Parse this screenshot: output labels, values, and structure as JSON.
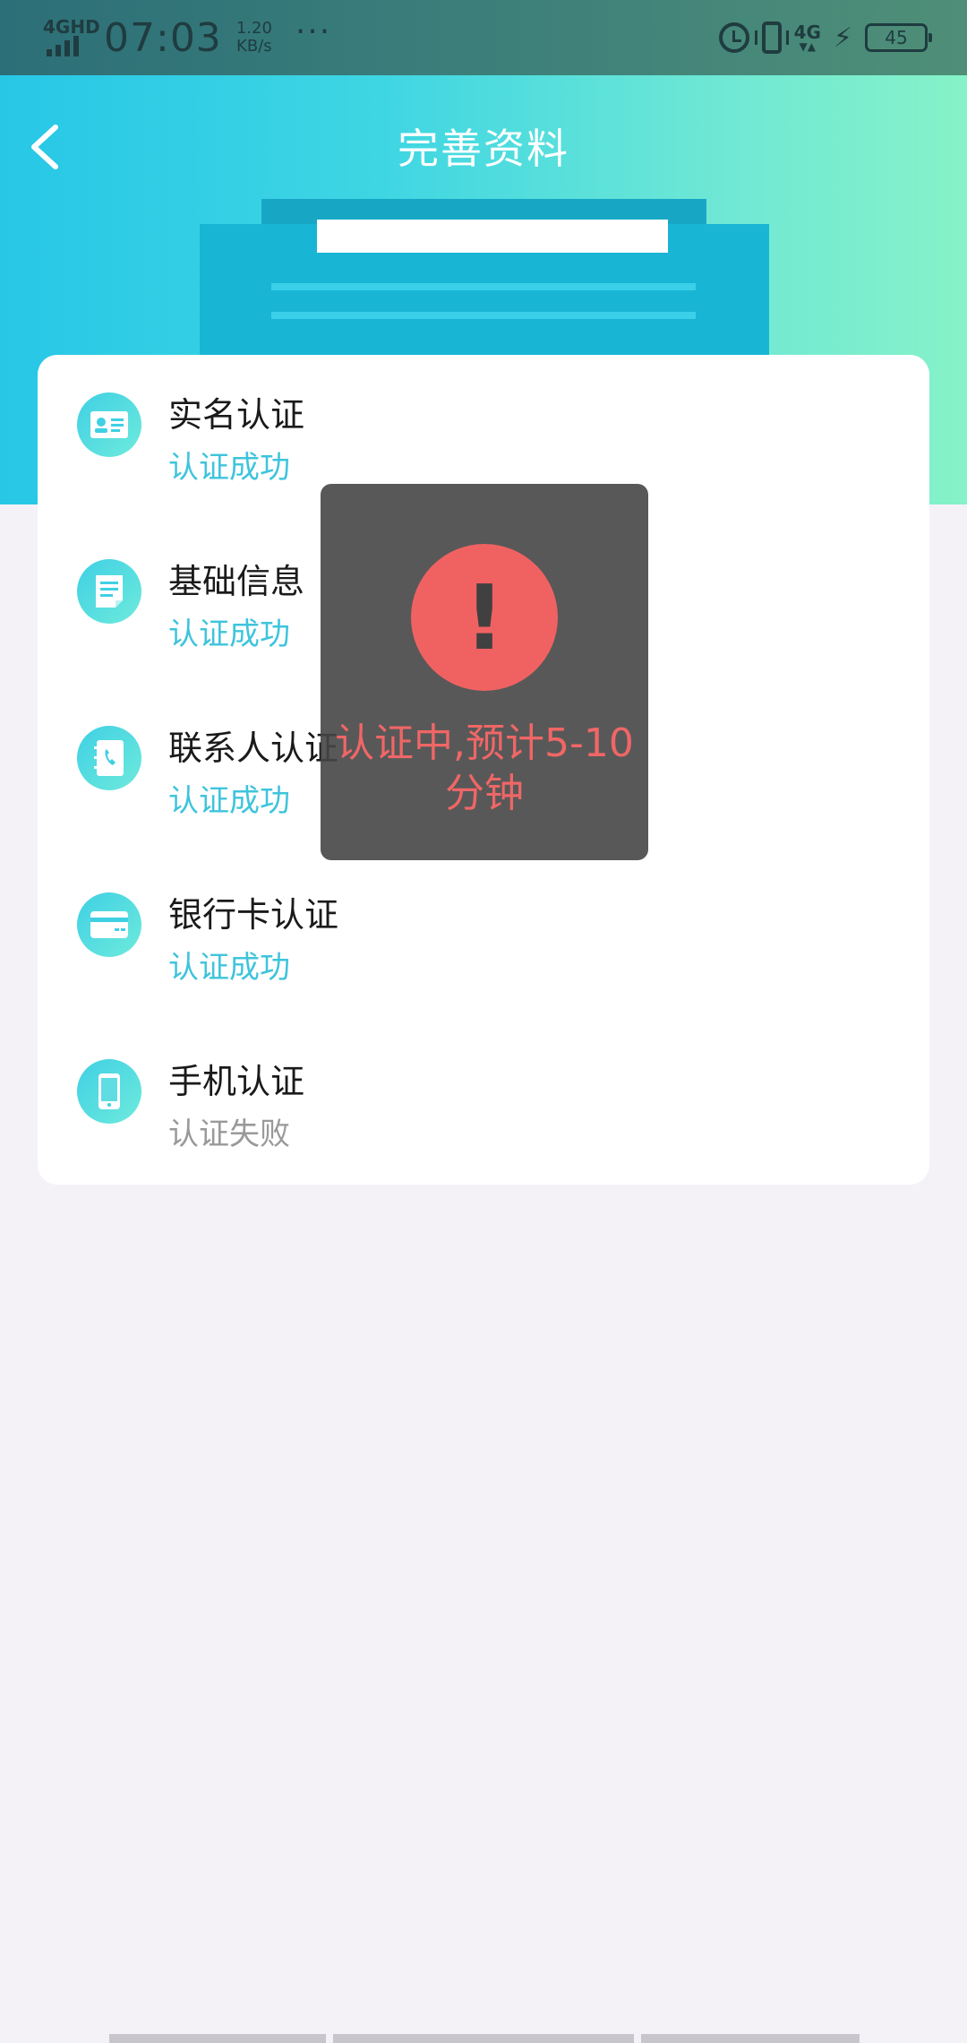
{
  "status_bar": {
    "network": "4GHD",
    "time": "07:03",
    "speed_value": "1.20",
    "speed_unit": "KB/s",
    "more": "···",
    "data_type": "4G",
    "battery": "45"
  },
  "nav": {
    "title": "完善资料"
  },
  "items": [
    {
      "title": "实名认证",
      "status": "认证成功",
      "icon": "id-card-icon"
    },
    {
      "title": "基础信息",
      "status": "认证成功",
      "icon": "document-icon"
    },
    {
      "title": "联系人认证",
      "status": "认证成功",
      "icon": "contact-book-icon"
    },
    {
      "title": "银行卡认证",
      "status": "认证成功",
      "icon": "bank-card-icon"
    },
    {
      "title": "手机认证",
      "status": "认证失败",
      "icon": "phone-icon"
    }
  ],
  "toast": {
    "symbol": "!",
    "message": "认证中,预计5-10分钟"
  },
  "colors": {
    "accent": "#3fc4dc",
    "fail": "#999999",
    "toast_alert": "#f06262"
  }
}
